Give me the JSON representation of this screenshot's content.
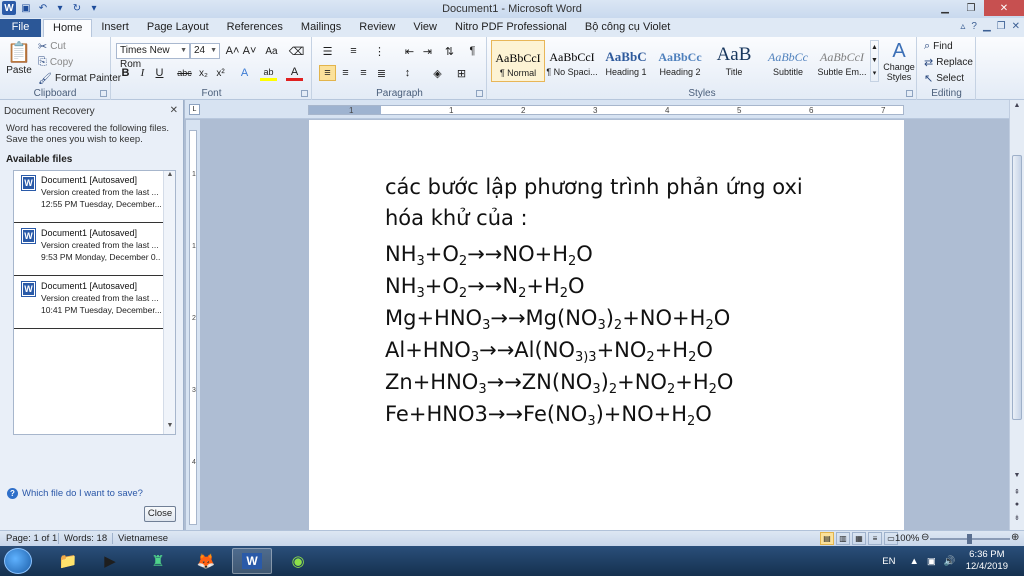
{
  "window": {
    "title": "Document1 - Microsoft Word"
  },
  "tabs": [
    "Home",
    "Insert",
    "Page Layout",
    "References",
    "Mailings",
    "Review",
    "View",
    "Nitro PDF Professional",
    "Bộ công cụ Violet"
  ],
  "file_tab": "File",
  "ribbon": {
    "clipboard": {
      "paste": "Paste",
      "cut": "Cut",
      "copy": "Copy",
      "format_painter": "Format Painter",
      "label": "Clipboard"
    },
    "font": {
      "name": "Times New Rom",
      "size": "24",
      "label": "Font",
      "bold": "B",
      "italic": "I",
      "underline": "U",
      "strike": "abc",
      "sub": "x₂",
      "sup": "x²",
      "grow": "A˄",
      "shrink": "A˅",
      "case": "Aa",
      "effects": "A",
      "highlight": "ab",
      "color": "A"
    },
    "paragraph": {
      "label": "Paragraph",
      "pilcrow": "¶"
    },
    "styles": {
      "label": "Styles",
      "items": [
        {
          "sample": "AaBbCcI",
          "name": "¶ Normal"
        },
        {
          "sample": "AaBbCcI",
          "name": "¶ No Spaci..."
        },
        {
          "sample": "AaBbC",
          "name": "Heading 1"
        },
        {
          "sample": "AaBbCc",
          "name": "Heading 2"
        },
        {
          "sample": "AaB",
          "name": "Title"
        },
        {
          "sample": "AaBbCc",
          "name": "Subtitle"
        },
        {
          "sample": "AaBbCcI",
          "name": "Subtle Em..."
        }
      ],
      "change_styles": "Change Styles"
    },
    "editing": {
      "label": "Editing",
      "find": "Find",
      "replace": "Replace",
      "select": "Select"
    }
  },
  "recovery": {
    "title": "Document Recovery",
    "description": "Word has recovered the following files.  Save the ones you wish to keep.",
    "available": "Available files",
    "items": [
      {
        "name": "Document1  [Autosaved]",
        "line2": "Version created from the last ...",
        "line3": "12:55 PM Tuesday, December..."
      },
      {
        "name": "Document1  [Autosaved]",
        "line2": "Version created from the last ...",
        "line3": "9:53 PM Monday, December 0..."
      },
      {
        "name": "Document1  [Autosaved]",
        "line2": "Version created from the last ...",
        "line3": "10:41 PM Tuesday, December..."
      }
    ],
    "help": "Which file do I want to save?",
    "close": "Close"
  },
  "document": {
    "intro_line1": "các bước lập phương trình phản ứng oxi",
    "intro_line2": "hóa khử của :",
    "equations": [
      [
        "NH",
        {
          "s": "3"
        },
        "+O",
        {
          "s": "2"
        },
        "→→NO+H",
        {
          "s": "2"
        },
        "O"
      ],
      [
        "NH",
        {
          "s": "3"
        },
        "+O",
        {
          "s": "2"
        },
        "→→N",
        {
          "s": "2"
        },
        "+H",
        {
          "s": "2"
        },
        "O"
      ],
      [
        "Mg+HNO",
        {
          "s": "3"
        },
        "→→Mg(NO",
        {
          "s": "3"
        },
        ")",
        {
          "s": "2"
        },
        "+NO+H",
        {
          "s": "2"
        },
        "O"
      ],
      [
        "Al+HNO",
        {
          "s": "3"
        },
        "→→Al(NO",
        {
          "s": "3)3"
        },
        "+NO",
        {
          "s": "2"
        },
        "+H",
        {
          "s": "2"
        },
        "O"
      ],
      [
        "Zn+HNO",
        {
          "s": "3"
        },
        "→→ZN(NO",
        {
          "s": "3"
        },
        ")",
        {
          "s": "2"
        },
        "+NO",
        {
          "s": "2"
        },
        "+H",
        {
          "s": "2"
        },
        "O"
      ],
      [
        "Fe+HNO3→→Fe(NO",
        {
          "s": "3"
        },
        ")+NO+H",
        {
          "s": "2"
        },
        "O"
      ]
    ]
  },
  "ruler": {
    "ticks": [
      "1",
      "1",
      "2",
      "3",
      "4",
      "5",
      "6",
      "7"
    ]
  },
  "status": {
    "page": "Page: 1 of 1",
    "words": "Words: 18",
    "language": "Vietnamese",
    "zoom": "100%"
  },
  "taskbar": {
    "lang": "EN",
    "time": "6:36 PM",
    "date": "12/4/2019"
  },
  "colors": {
    "file_tab": "#2b5797",
    "accent": "#2a5aa8",
    "page": "#ffffff",
    "workspace": "#aebdd3"
  }
}
